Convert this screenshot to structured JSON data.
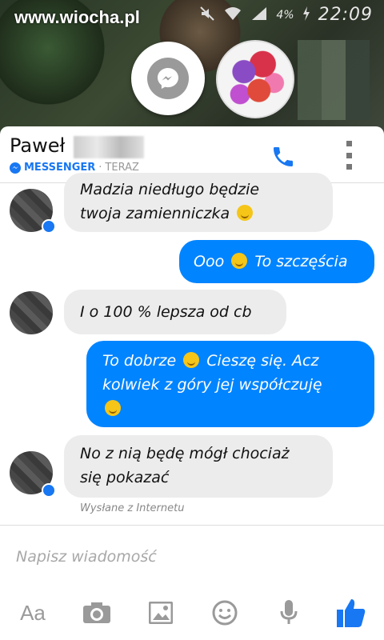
{
  "watermark": "www.wiocha.pl",
  "status": {
    "battery": "4%",
    "time": "22:09"
  },
  "header": {
    "name": "Paweł",
    "app": "MESSENGER",
    "separator": "·",
    "time": "TERAZ"
  },
  "messages": [
    {
      "dir": "in",
      "text_line1": "Madzia niedługo będzie",
      "text_line2": "twoja zamienniczka"
    },
    {
      "dir": "out",
      "text_a": "Ooo",
      "text_b": "To szczęścia"
    },
    {
      "dir": "in",
      "text": "I o 100 % lepsza od cb"
    },
    {
      "dir": "out",
      "text_a": "To dobrze",
      "text_b": "Cieszę się. Acz",
      "text_line2": "kolwiek z góry jej współczuję"
    },
    {
      "dir": "in",
      "text_line1": "No z nią będę mógł chociaż",
      "text_line2": "się pokazać"
    }
  ],
  "footnote": "Wysłane z Internetu",
  "composer": {
    "placeholder": "Napisz wiadomość",
    "aa_label": "Aa"
  },
  "colors": {
    "accent": "#0084ff",
    "brand": "#1877f2",
    "bubble_in": "#ececec"
  }
}
